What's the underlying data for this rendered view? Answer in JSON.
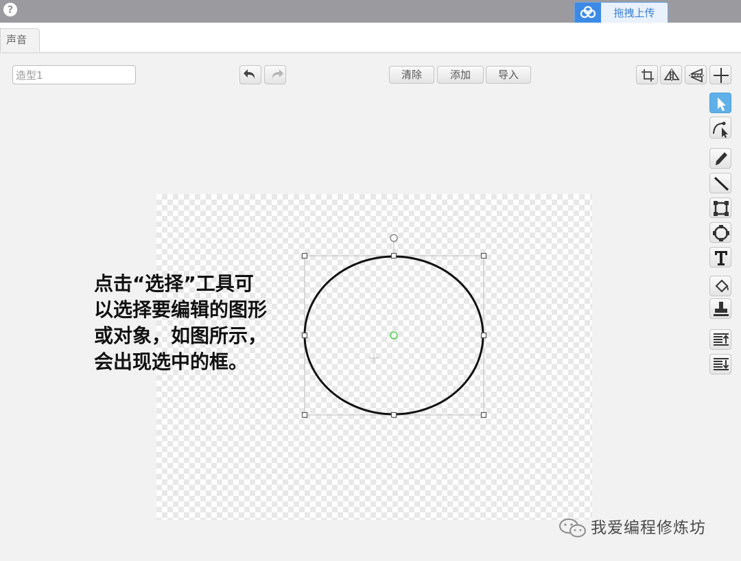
{
  "upload_button_label": "拖拽上传",
  "tabs": {
    "sound": "声音"
  },
  "costume_name": "造型1",
  "actions": {
    "clear": "清除",
    "add": "添加",
    "import": "导入"
  },
  "annotation": "点击“选择”工具可以选择要编辑的图形或对象，如图所示，会出现选中的框。",
  "watermark": "我爱编程修炼坊",
  "colors": {
    "accent": "#5fb0e8",
    "topbar": "#9b9b9f",
    "selection_center": "#55cc55"
  },
  "tools_right": [
    "select",
    "reshape",
    "pencil",
    "line",
    "rectangle",
    "ellipse",
    "text",
    "fill",
    "stamp",
    "move-forward",
    "move-backward"
  ],
  "tools_top": [
    "crop",
    "flip-horizontal",
    "flip-vertical",
    "set-costume-center"
  ],
  "active_tool": "select"
}
